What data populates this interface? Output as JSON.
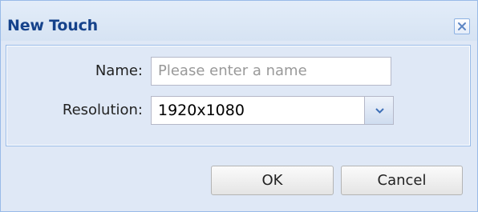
{
  "dialog": {
    "title": "New Touch",
    "close_icon": "close-icon"
  },
  "form": {
    "name": {
      "label": "Name:",
      "value": "",
      "placeholder": "Please enter a name"
    },
    "resolution": {
      "label": "Resolution:",
      "selected": "1920x1080",
      "trigger_icon": "chevron-down-icon"
    }
  },
  "buttons": {
    "ok_label": "OK",
    "cancel_label": "Cancel"
  },
  "colors": {
    "title_text": "#15428b",
    "frame_border": "#99bbe8",
    "frame_background": "#dfe8f6"
  }
}
